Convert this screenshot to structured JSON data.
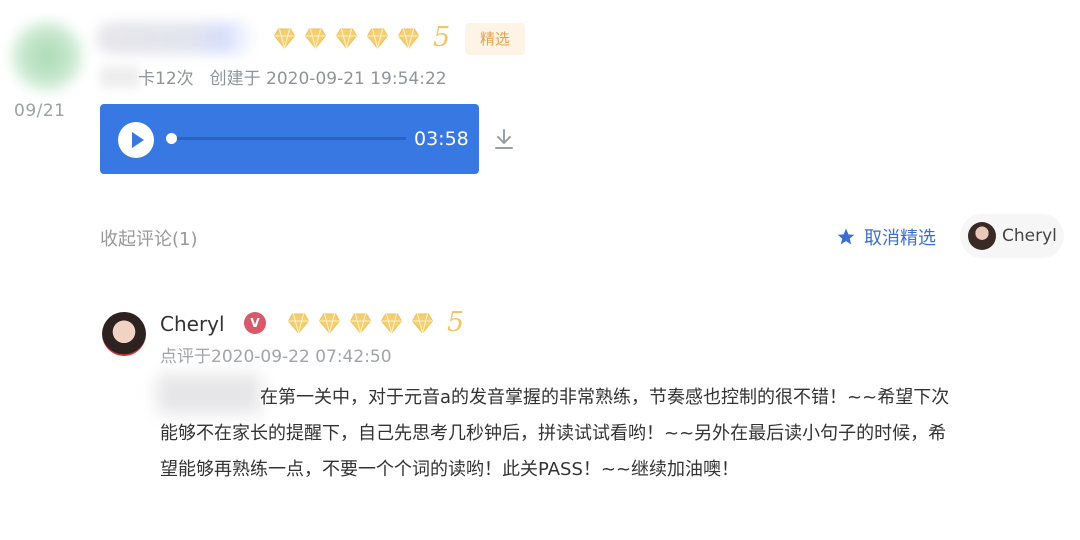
{
  "submission": {
    "side_date": "09/21",
    "rating": 5,
    "badge": "精选",
    "checkin": "卡12次",
    "created": "创建于 2020-09-21 19:54:22"
  },
  "player": {
    "time": "03:58",
    "progress": 0
  },
  "actions": {
    "collapse_comments": "收起评论(1)",
    "unfeature": "取消精选",
    "teacher_chip": "Cheryl"
  },
  "review": {
    "teacher_name": "Cheryl",
    "verified_badge": "V",
    "rating": 5,
    "date": "点评于2020-09-22 07:42:50",
    "comment": "在第一关中，对于元音a的发音掌握的非常熟练，节奏感也控制的很不错！~~希望下次能够不在家长的提醒下，自己先思考几秒钟后，拼读试试看哟！~~另外在最后读小句子的时候，希望能够再熟练一点，不要一个个词的读哟！此关PASS！~~继续加油噢！"
  },
  "colors": {
    "accent": "#3878e2",
    "star": "#f5cf6f",
    "badge_text": "#e3a34a"
  },
  "icons": [
    "play-icon",
    "download-icon",
    "star-icon",
    "heart-rating-icon",
    "verified-icon"
  ]
}
